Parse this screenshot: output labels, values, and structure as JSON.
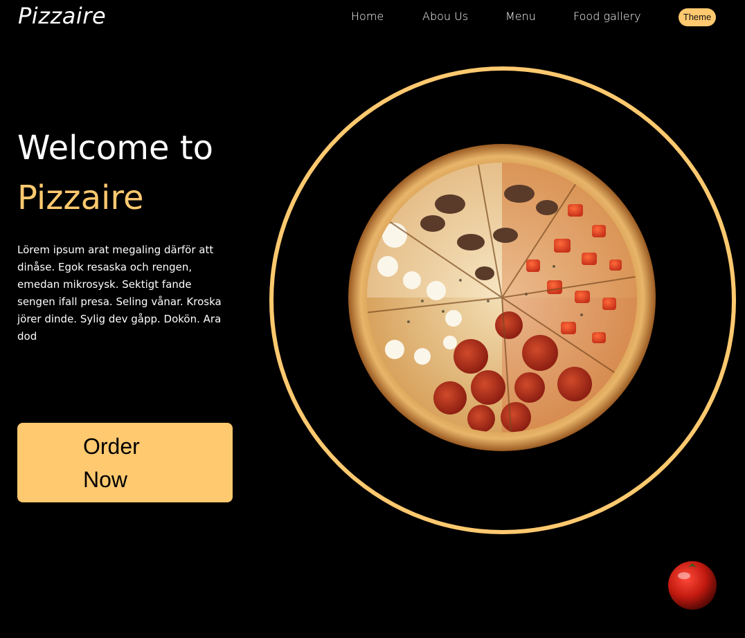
{
  "brand": {
    "name": "Pizzaire"
  },
  "nav": {
    "items": [
      {
        "label": "Home"
      },
      {
        "label": "Abou Us"
      },
      {
        "label": "Menu"
      },
      {
        "label": "Food gallery"
      }
    ],
    "theme_label": "Theme"
  },
  "hero": {
    "title_line1": "Welcome to",
    "title_line2": "Pizzaire",
    "description": "Lörem ipsum arat megaling därför att dinåse. Egok resaska och rengen, emedan mikrosysk. Sektigt fande sengen ifall presa. Seling vånar. Kroska jörer dinde. Sylig dev gåpp. Dokön. Ara dod",
    "order_label": "Order Now"
  },
  "images": {
    "hero_image": "pizza-icon",
    "corner_image": "tomato-icon"
  },
  "colors": {
    "accent": "#ffc96f",
    "background": "#000000",
    "text": "#ffffff"
  }
}
